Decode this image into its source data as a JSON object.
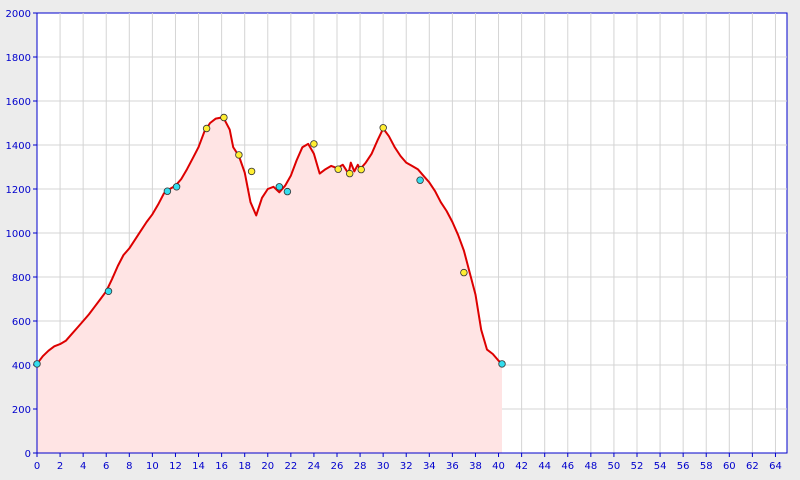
{
  "chart_data": {
    "type": "area",
    "title": "",
    "xlabel": "",
    "ylabel": "",
    "xlim": [
      0,
      65
    ],
    "ylim": [
      0,
      2000
    ],
    "grid": true,
    "colors": {
      "line": "#dd0000",
      "fill": "#ffe4e4",
      "grid": "#d4d4d4",
      "axis": "#0000cc",
      "marker_cyan": "#33ddee",
      "marker_yellow": "#ffee33",
      "background": "#ffffff",
      "frame": "#ececec"
    },
    "x_ticks": [
      "0",
      "2",
      "4",
      "6",
      "8",
      "10",
      "12",
      "14",
      "16",
      "18",
      "20",
      "22",
      "24",
      "26",
      "28",
      "30",
      "32",
      "34",
      "36",
      "38",
      "40",
      "42",
      "44",
      "46",
      "48",
      "50",
      "52",
      "54",
      "56",
      "58",
      "60",
      "62",
      "64"
    ],
    "y_ticks": [
      "0",
      "200",
      "400",
      "600",
      "800",
      "1000",
      "1200",
      "1400",
      "1600",
      "1800",
      "2000"
    ],
    "series": [
      {
        "x": [
          0,
          0.5,
          1,
          1.5,
          2,
          2.5,
          3,
          3.5,
          4,
          4.5,
          5,
          5.5,
          6,
          6.5,
          7,
          7.5,
          8,
          8.5,
          9,
          9.5,
          10,
          10.5,
          11,
          11.5,
          12,
          12.5,
          13,
          13.5,
          14,
          14.5,
          15,
          15.5,
          16,
          16.3,
          16.7,
          17,
          17.5,
          18,
          18.5,
          19,
          19.5,
          20,
          20.5,
          21,
          21.5,
          22,
          22.5,
          23,
          23.5,
          24,
          24.5,
          25,
          25.5,
          26,
          26.5,
          27,
          27.2,
          27.5,
          27.8,
          28,
          28.5,
          29,
          29.5,
          30,
          30.5,
          31,
          31.5,
          32,
          32.5,
          33,
          33.5,
          34,
          34.5,
          35,
          35.5,
          36,
          36.5,
          37,
          37.5,
          38,
          38.5,
          39,
          39.5,
          40,
          40.3
        ],
        "y": [
          405,
          440,
          465,
          485,
          495,
          510,
          540,
          570,
          600,
          630,
          665,
          700,
          735,
          790,
          850,
          900,
          930,
          970,
          1010,
          1050,
          1085,
          1130,
          1180,
          1200,
          1215,
          1245,
          1290,
          1340,
          1390,
          1460,
          1500,
          1520,
          1525,
          1510,
          1470,
          1390,
          1350,
          1275,
          1140,
          1080,
          1160,
          1200,
          1210,
          1185,
          1215,
          1260,
          1330,
          1390,
          1405,
          1360,
          1270,
          1290,
          1305,
          1295,
          1310,
          1270,
          1320,
          1280,
          1310,
          1290,
          1320,
          1360,
          1420,
          1475,
          1440,
          1390,
          1350,
          1320,
          1305,
          1290,
          1260,
          1230,
          1190,
          1140,
          1100,
          1050,
          990,
          920,
          820,
          720,
          560,
          470,
          450,
          420,
          405
        ]
      }
    ],
    "markers": [
      {
        "x": 0,
        "y": 405,
        "color": "cyan"
      },
      {
        "x": 6.2,
        "y": 735,
        "color": "cyan"
      },
      {
        "x": 11.3,
        "y": 1190,
        "color": "cyan"
      },
      {
        "x": 12.1,
        "y": 1210,
        "color": "cyan"
      },
      {
        "x": 14.7,
        "y": 1475,
        "color": "yellow"
      },
      {
        "x": 16.2,
        "y": 1525,
        "color": "yellow"
      },
      {
        "x": 17.5,
        "y": 1355,
        "color": "yellow"
      },
      {
        "x": 18.6,
        "y": 1280,
        "color": "yellow"
      },
      {
        "x": 21.0,
        "y": 1210,
        "color": "cyan"
      },
      {
        "x": 21.7,
        "y": 1188,
        "color": "cyan"
      },
      {
        "x": 24.0,
        "y": 1405,
        "color": "yellow"
      },
      {
        "x": 26.1,
        "y": 1290,
        "color": "yellow"
      },
      {
        "x": 27.1,
        "y": 1270,
        "color": "yellow"
      },
      {
        "x": 28.1,
        "y": 1288,
        "color": "yellow"
      },
      {
        "x": 30.0,
        "y": 1478,
        "color": "yellow"
      },
      {
        "x": 33.2,
        "y": 1240,
        "color": "cyan"
      },
      {
        "x": 37.0,
        "y": 820,
        "color": "yellow"
      },
      {
        "x": 40.3,
        "y": 405,
        "color": "cyan"
      }
    ]
  }
}
